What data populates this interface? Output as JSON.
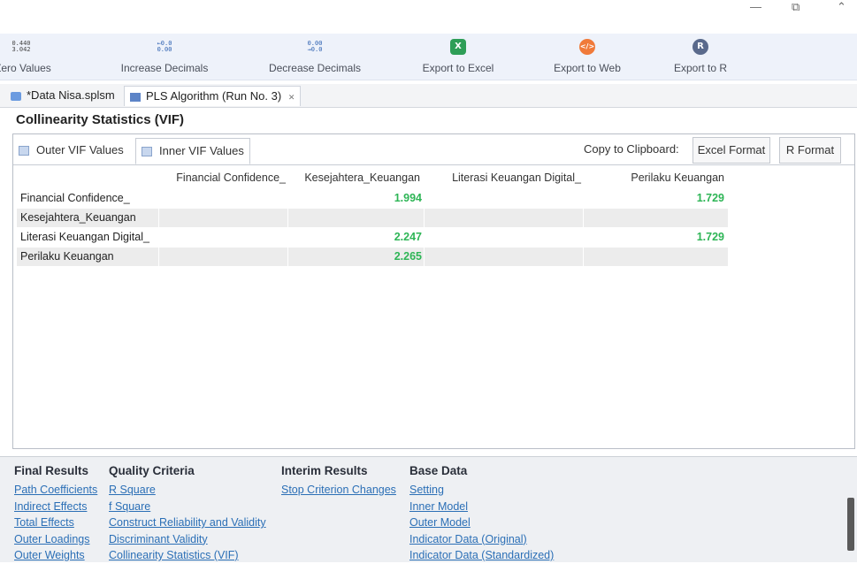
{
  "window": {
    "minimize": "—",
    "restore": "⧉",
    "close": "⌃"
  },
  "toolbar": {
    "items": [
      {
        "label": "Zero Values",
        "icon": "zero-values-icon",
        "glyph": "0.440\n3.042"
      },
      {
        "label": "Increase Decimals",
        "icon": "increase-decimals-icon",
        "glyph": "←0.0\n0.00"
      },
      {
        "label": "Decrease Decimals",
        "icon": "decrease-decimals-icon",
        "glyph": "0.00\n→0.0"
      },
      {
        "label": "Export to Excel",
        "icon": "excel-icon",
        "glyph": "X",
        "color": "#2e9e57"
      },
      {
        "label": "Export to Web",
        "icon": "web-icon",
        "glyph": "</>",
        "color": "#f07a3a"
      },
      {
        "label": "Export to R",
        "icon": "r-icon",
        "glyph": "R",
        "color": "#5a6a8c"
      }
    ]
  },
  "tabs": [
    {
      "label": "*Data Nisa.splsm"
    },
    {
      "label": "PLS Algorithm (Run No. 3)",
      "close": "✕"
    }
  ],
  "heading": "Collinearity Statistics (VIF)",
  "subtabs": [
    {
      "label": "Outer VIF Values"
    },
    {
      "label": "Inner VIF Values"
    }
  ],
  "clipboard": {
    "label": "Copy to Clipboard:",
    "excel": "Excel Format",
    "r": "R Format"
  },
  "table": {
    "columns": [
      "Financial Confidence_",
      "Kesejahtera_Keuangan",
      "Literasi Keuangan Digital_",
      "Perilaku Keuangan"
    ],
    "rows": [
      {
        "label": "Financial Confidence_",
        "values": [
          "",
          "1.994",
          "",
          "1.729"
        ]
      },
      {
        "label": "Kesejahtera_Keuangan",
        "values": [
          "",
          "",
          "",
          ""
        ]
      },
      {
        "label": "Literasi Keuangan Digital_",
        "values": [
          "",
          "2.247",
          "",
          "1.729"
        ]
      },
      {
        "label": "Perilaku Keuangan",
        "values": [
          "",
          "2.265",
          "",
          ""
        ]
      }
    ],
    "value_color": "#2eb556"
  },
  "nav": {
    "final_results": {
      "title": "Final Results",
      "links": [
        "Path Coefficients",
        "Indirect Effects",
        "Total Effects",
        "Outer Loadings",
        "Outer Weights"
      ]
    },
    "quality_criteria": {
      "title": "Quality Criteria",
      "links": [
        "R Square",
        "f Square",
        "Construct Reliability and Validity",
        "Discriminant Validity",
        "Collinearity Statistics (VIF)"
      ]
    },
    "interim_results": {
      "title": "Interim Results",
      "links": [
        "Stop Criterion Changes"
      ]
    },
    "base_data": {
      "title": "Base Data",
      "links": [
        "Setting",
        "Inner Model",
        "Outer Model",
        "Indicator Data (Original)",
        "Indicator Data (Standardized)"
      ]
    }
  }
}
